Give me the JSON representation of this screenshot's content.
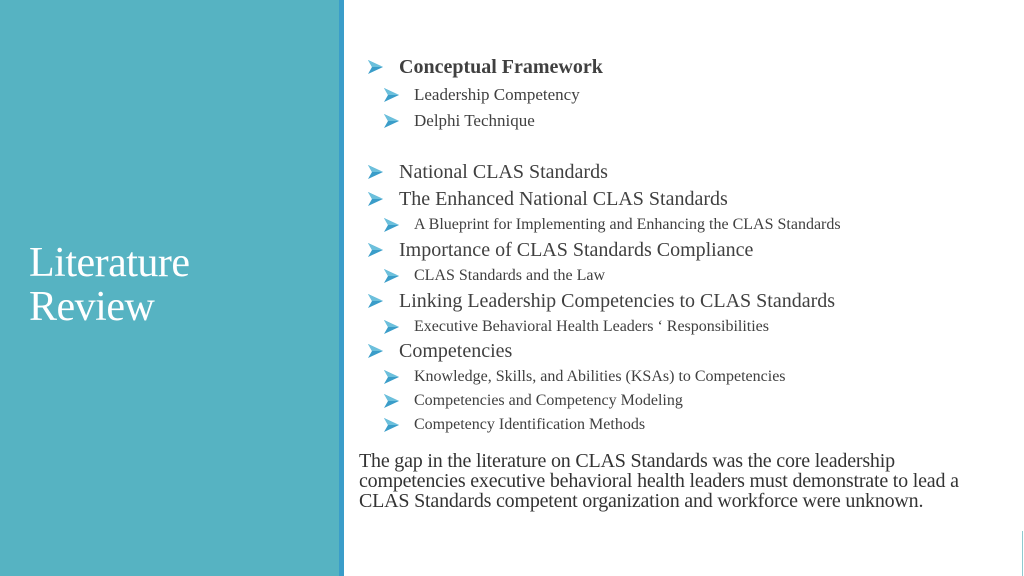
{
  "slide": {
    "title_lines": [
      "Literature",
      "Review"
    ],
    "colors": {
      "sidebar": "#56b3c2",
      "accent_strip": "#3a9dc9",
      "bullet": "#3a9dc9",
      "text": "#404040"
    },
    "bullet_icon": "arrowhead-bullet-icon",
    "outline": [
      {
        "level": 1,
        "bold": true,
        "text": "Conceptual Framework"
      },
      {
        "level": 2,
        "text": "Leadership Competency"
      },
      {
        "level": 2,
        "text": "Delphi Technique"
      },
      {
        "level": 1,
        "text": "National CLAS Standards"
      },
      {
        "level": 1,
        "text": "The Enhanced National CLAS Standards"
      },
      {
        "level": 2,
        "text": "A Blueprint for Implementing and Enhancing the CLAS Standards"
      },
      {
        "level": 1,
        "text": "Importance of CLAS Standards Compliance"
      },
      {
        "level": 2,
        "text": "CLAS Standards and the Law"
      },
      {
        "level": 1,
        "text": "Linking Leadership Competencies to CLAS Standards"
      },
      {
        "level": 2,
        "text": "Executive Behavioral Health Leaders ‘ Responsibilities"
      },
      {
        "level": 1,
        "text": "Competencies"
      },
      {
        "level": 2,
        "text": "Knowledge, Skills, and Abilities (KSAs) to Competencies"
      },
      {
        "level": 2,
        "text": "Competencies and Competency Modeling"
      },
      {
        "level": 2,
        "text": "Competency Identification Methods"
      }
    ],
    "summary_lines": [
      "The gap in the literature on CLAS Standards was the core leadership",
      "competencies executive behavioral health leaders must demonstrate to lead a",
      "CLAS Standards competent organization and workforce were unknown."
    ]
  }
}
